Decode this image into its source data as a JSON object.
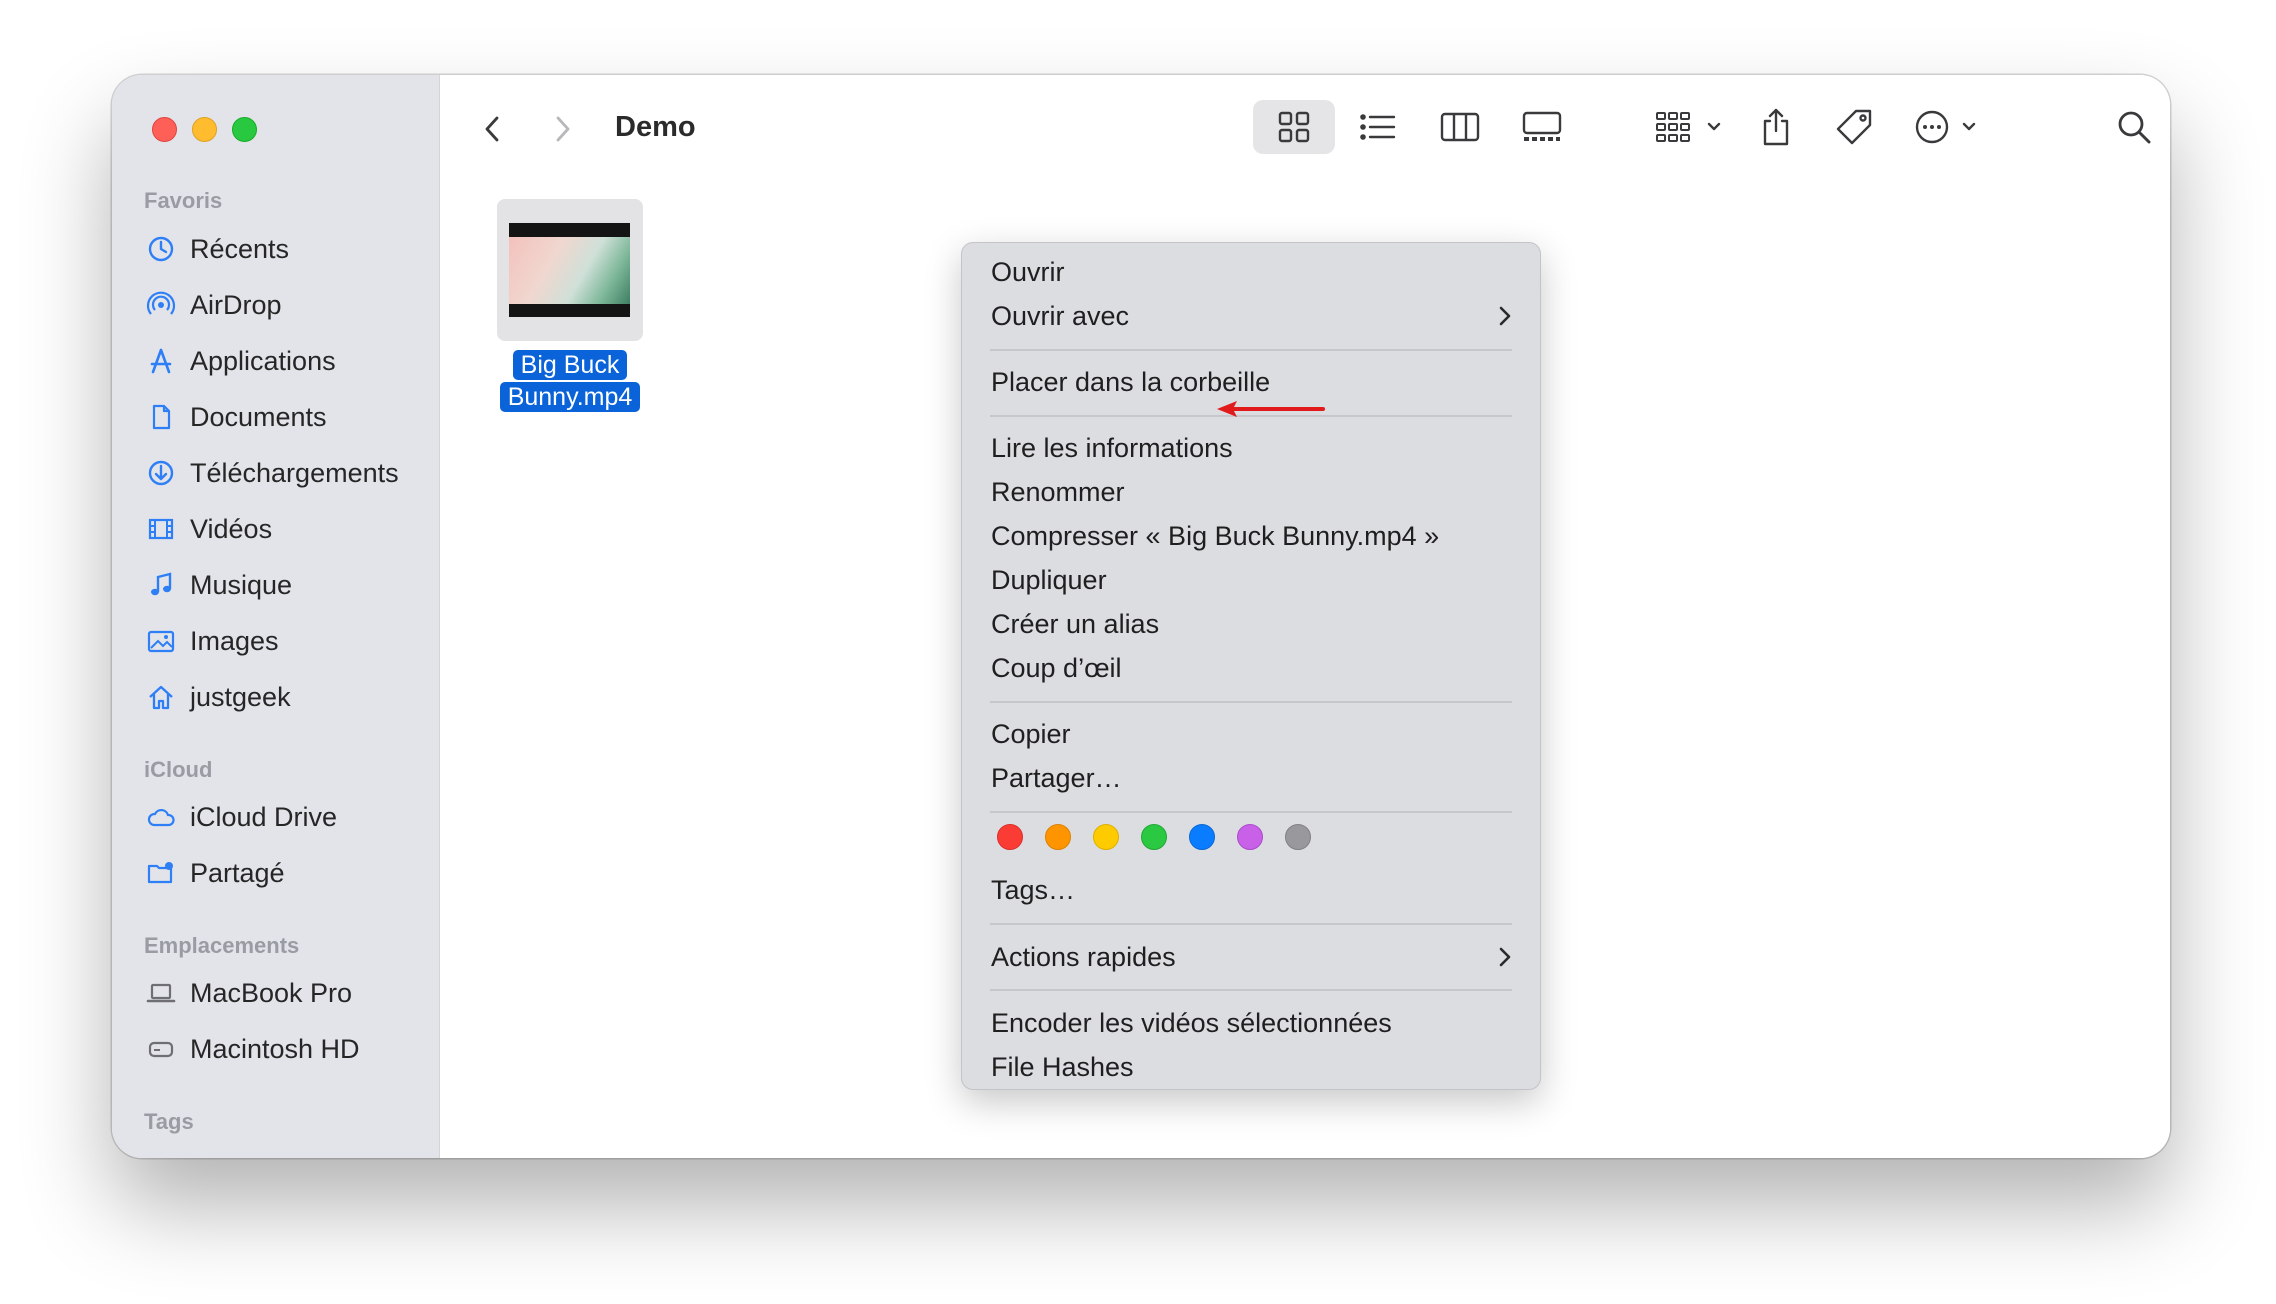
{
  "window": {
    "title": "Demo"
  },
  "sidebar": {
    "sections": [
      {
        "heading": "Favoris",
        "items": [
          {
            "label": "Récents",
            "icon": "clock-icon"
          },
          {
            "label": "AirDrop",
            "icon": "airdrop-icon"
          },
          {
            "label": "Applications",
            "icon": "applications-icon"
          },
          {
            "label": "Documents",
            "icon": "document-icon"
          },
          {
            "label": "Téléchargements",
            "icon": "download-icon"
          },
          {
            "label": "Vidéos",
            "icon": "film-icon"
          },
          {
            "label": "Musique",
            "icon": "music-icon"
          },
          {
            "label": "Images",
            "icon": "photo-icon"
          },
          {
            "label": "justgeek",
            "icon": "home-icon"
          }
        ]
      },
      {
        "heading": "iCloud",
        "items": [
          {
            "label": "iCloud Drive",
            "icon": "cloud-icon"
          },
          {
            "label": "Partagé",
            "icon": "shared-folder-icon"
          }
        ]
      },
      {
        "heading": "Emplacements",
        "items": [
          {
            "label": "MacBook Pro",
            "icon": "laptop-icon"
          },
          {
            "label": "Macintosh HD",
            "icon": "disk-icon"
          }
        ]
      },
      {
        "heading": "Tags",
        "items": []
      }
    ]
  },
  "file": {
    "name_line1": "Big Buck",
    "name_line2": "Bunny.mp4"
  },
  "context_menu": {
    "groups": [
      [
        {
          "label": "Ouvrir"
        },
        {
          "label": "Ouvrir avec",
          "submenu": true
        }
      ],
      [
        {
          "label": "Placer dans la corbeille"
        }
      ],
      [
        {
          "label": "Lire les informations",
          "highlighted_by_arrow": true
        },
        {
          "label": "Renommer"
        },
        {
          "label": "Compresser « Big Buck Bunny.mp4 »"
        },
        {
          "label": "Dupliquer"
        },
        {
          "label": "Créer un alias"
        },
        {
          "label": "Coup d’œil"
        }
      ],
      [
        {
          "label": "Copier"
        },
        {
          "label": "Partager…"
        }
      ],
      [
        {
          "label": "Tags…"
        }
      ],
      [
        {
          "label": "Actions rapides",
          "submenu": true
        }
      ],
      [
        {
          "label": "Encoder les vidéos sélectionnées"
        },
        {
          "label": "File Hashes"
        }
      ]
    ],
    "tag_colors": [
      "#fb3c35",
      "#fe9500",
      "#fecb00",
      "#2bc842",
      "#0a7cff",
      "#c860e8",
      "#98989d"
    ],
    "annotation_arrow_color": "#e11b1b"
  },
  "colors": {
    "selection": "#0a63d9",
    "sidebar_bg": "#e2e4ea",
    "accent_icon": "#2e7ff6"
  }
}
